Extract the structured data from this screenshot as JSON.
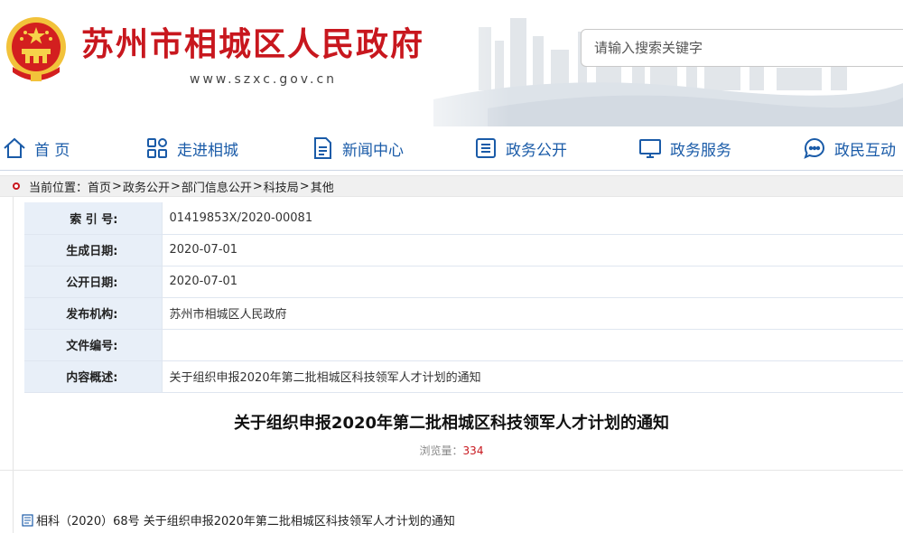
{
  "header": {
    "site_title": "苏州市相城区人民政府",
    "site_url": "www.szxc.gov.cn",
    "search_placeholder": "请输入搜索关键字"
  },
  "nav": [
    {
      "label": "首 页",
      "icon": "home-icon"
    },
    {
      "label": "走进相城",
      "icon": "grid-icon"
    },
    {
      "label": "新闻中心",
      "icon": "document-icon"
    },
    {
      "label": "政务公开",
      "icon": "list-icon"
    },
    {
      "label": "政务服务",
      "icon": "monitor-icon"
    },
    {
      "label": "政民互动",
      "icon": "chat-icon"
    }
  ],
  "breadcrumb": {
    "prefix": "当前位置：",
    "items": [
      "首页",
      "政务公开",
      "部门信息公开",
      "科技局",
      "其他"
    ],
    "separator": ">"
  },
  "meta": [
    {
      "key": "索 引 号:",
      "value": "01419853X/2020-00081"
    },
    {
      "key": "生成日期:",
      "value": "2020-07-01"
    },
    {
      "key": "公开日期:",
      "value": "2020-07-01"
    },
    {
      "key": "发布机构:",
      "value": "苏州市相城区人民政府"
    },
    {
      "key": "文件编号:",
      "value": ""
    },
    {
      "key": "内容概述:",
      "value": "关于组织申报2020年第二批相城区科技领军人才计划的通知"
    }
  ],
  "article": {
    "title": "关于组织申报2020年第二批相城区科技领军人才计划的通知",
    "views_label": "浏览量：",
    "views_count": "334",
    "attachment": "相科（2020）68号 关于组织申报2020年第二批相城区科技领军人才计划的通知"
  },
  "colors": {
    "brand_red": "#c8171e",
    "nav_blue": "#1a5ba8",
    "meta_key_bg": "#e8eff8"
  }
}
